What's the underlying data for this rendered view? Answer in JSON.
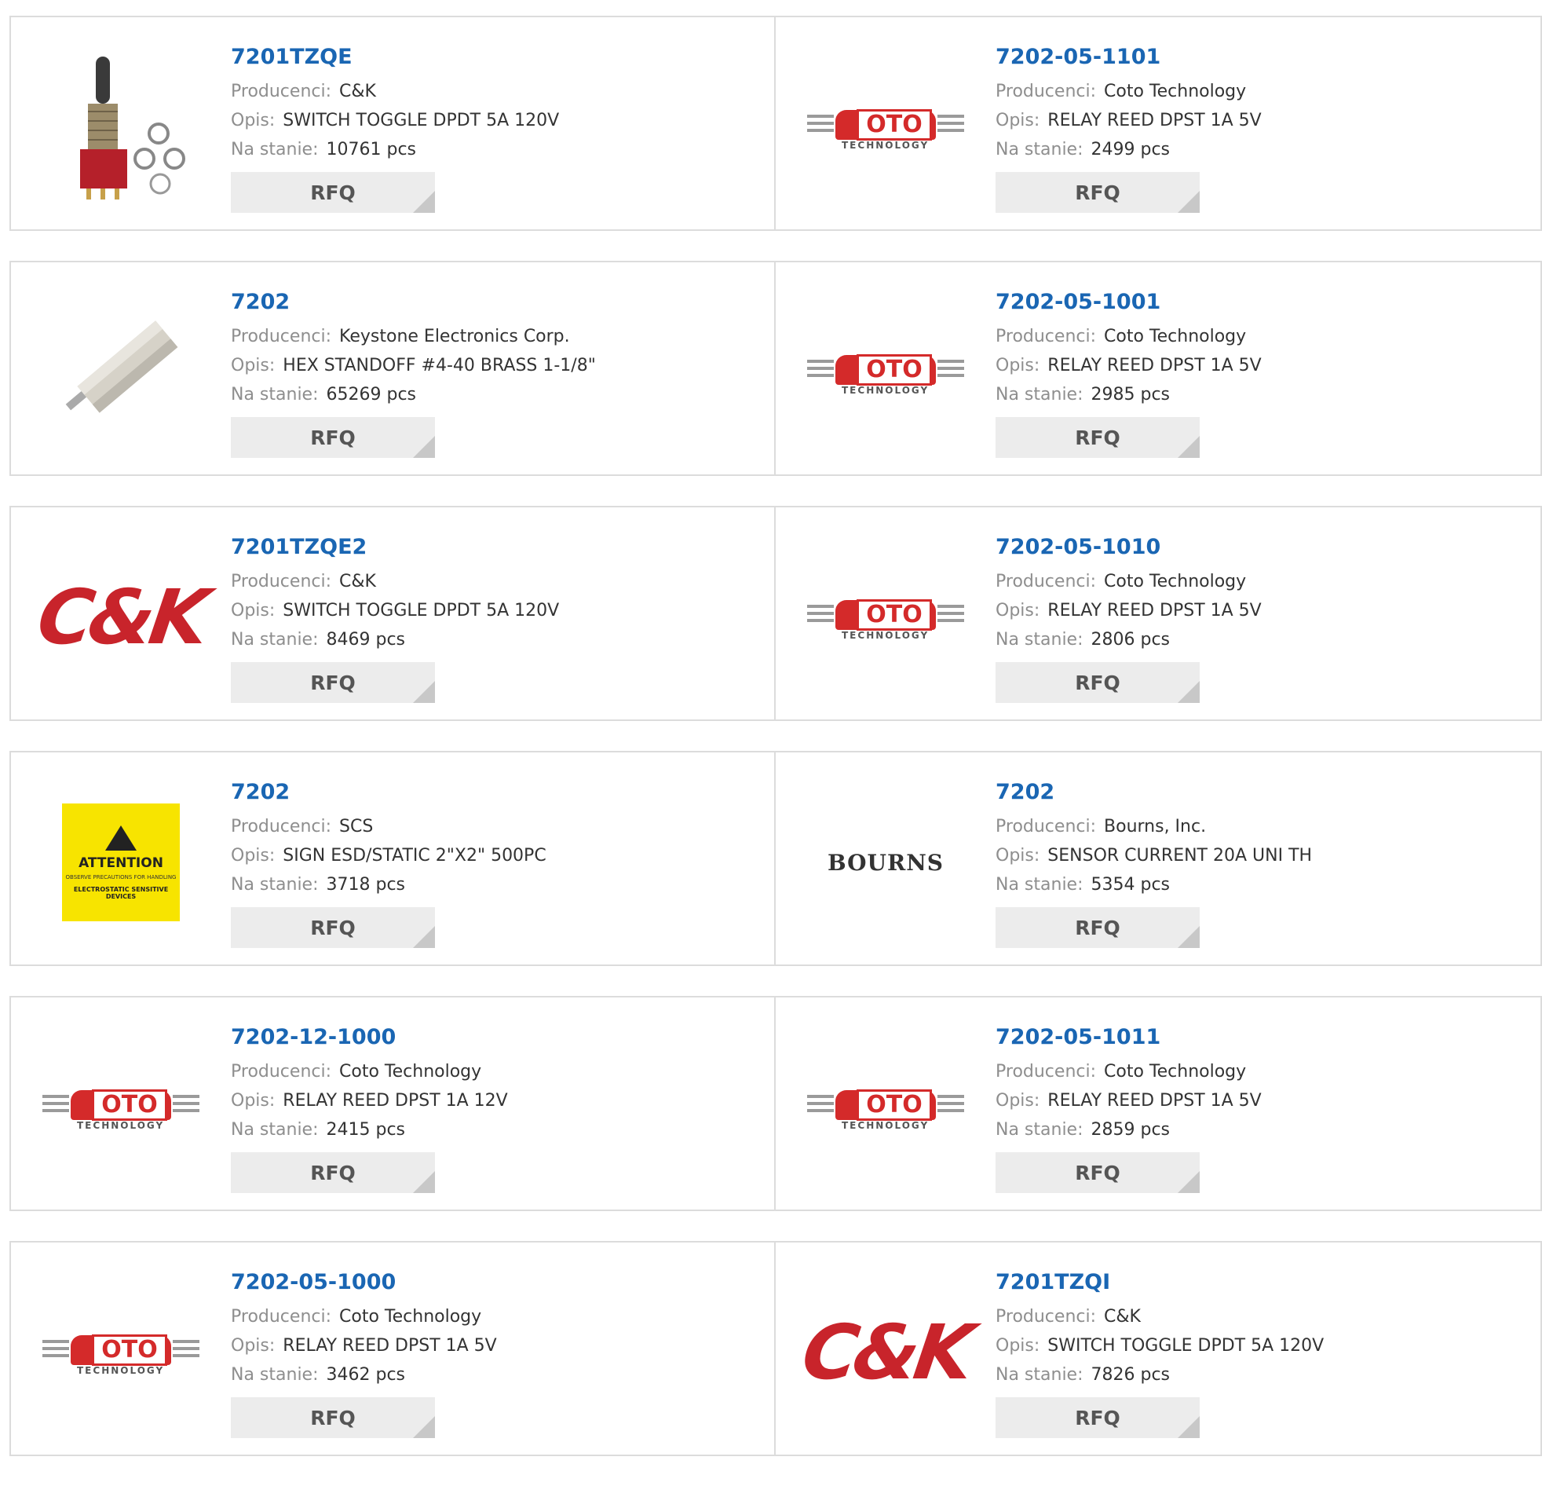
{
  "labels": {
    "manufacturer": "Producenci:",
    "description": "Opis:",
    "stock": "Na stanie:",
    "rfq": "RFQ"
  },
  "products": [
    {
      "pn": "7201TZQE",
      "manufacturer": "C&K",
      "description": "SWITCH TOGGLE DPDT 5A 120V",
      "stock": "10761 pcs",
      "image": "toggle-switch-photo"
    },
    {
      "pn": "7202-05-1101",
      "manufacturer": "Coto Technology",
      "description": "RELAY REED DPST 1A 5V",
      "stock": "2499 pcs",
      "image": "coto-logo"
    },
    {
      "pn": "7202",
      "manufacturer": "Keystone Electronics Corp.",
      "description": "HEX STANDOFF #4-40 BRASS 1-1/8\"",
      "stock": "65269 pcs",
      "image": "standoff-photo"
    },
    {
      "pn": "7202-05-1001",
      "manufacturer": "Coto Technology",
      "description": "RELAY REED DPST 1A 5V",
      "stock": "2985 pcs",
      "image": "coto-logo"
    },
    {
      "pn": "7201TZQE2",
      "manufacturer": "C&K",
      "description": "SWITCH TOGGLE DPDT 5A 120V",
      "stock": "8469 pcs",
      "image": "ck-logo"
    },
    {
      "pn": "7202-05-1010",
      "manufacturer": "Coto Technology",
      "description": "RELAY REED DPST 1A 5V",
      "stock": "2806 pcs",
      "image": "coto-logo"
    },
    {
      "pn": "7202",
      "manufacturer": "SCS",
      "description": "SIGN ESD/STATIC 2\"X2\" 500PC",
      "stock": "3718 pcs",
      "image": "attention-sign"
    },
    {
      "pn": "7202",
      "manufacturer": "Bourns, Inc.",
      "description": "SENSOR CURRENT 20A UNI TH",
      "stock": "5354 pcs",
      "image": "bourns-logo"
    },
    {
      "pn": "7202-12-1000",
      "manufacturer": "Coto Technology",
      "description": "RELAY REED DPST 1A 12V",
      "stock": "2415 pcs",
      "image": "coto-logo"
    },
    {
      "pn": "7202-05-1011",
      "manufacturer": "Coto Technology",
      "description": "RELAY REED DPST 1A 5V",
      "stock": "2859 pcs",
      "image": "coto-logo"
    },
    {
      "pn": "7202-05-1000",
      "manufacturer": "Coto Technology",
      "description": "RELAY REED DPST 1A 5V",
      "stock": "3462 pcs",
      "image": "coto-logo"
    },
    {
      "pn": "7201TZQI",
      "manufacturer": "C&K",
      "description": "SWITCH TOGGLE DPDT 5A 120V",
      "stock": "7826 pcs",
      "image": "ck-logo"
    }
  ],
  "logo_text": {
    "coto": "OTO",
    "coto_sub": "TECHNOLOGY",
    "ck": "C&K",
    "bourns": "BOURNS",
    "attention": "ATTENTION",
    "attention_small": "OBSERVE PRECAUTIONS FOR HANDLING",
    "attention_devices": "ELECTROSTATIC SENSITIVE DEVICES"
  },
  "colors": {
    "link": "#1a66b3",
    "coto_red": "#d42a2a",
    "ck_red": "#c8242b",
    "sign_yellow": "#f7e400"
  }
}
